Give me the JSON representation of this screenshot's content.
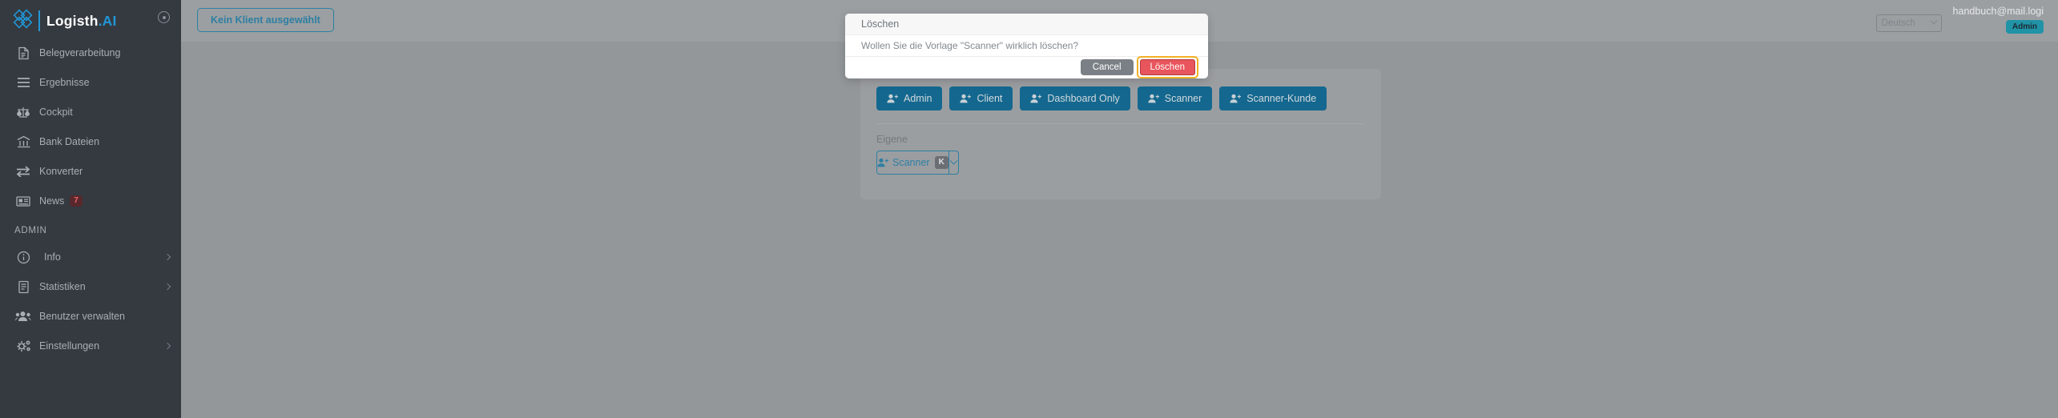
{
  "brand": {
    "name_main": "Logisth",
    "name_dot": ".",
    "name_ai": "AI",
    "logo_icon": "clover-diamond-logo",
    "collapse_icon": "collapse-circle-icon"
  },
  "sidebar": {
    "items": [
      {
        "label": "Belegverarbeitung",
        "icon": "document-icon",
        "badge": null,
        "chevron": false
      },
      {
        "label": "Ergebnisse",
        "icon": "list-lines-icon",
        "badge": null,
        "chevron": false
      },
      {
        "label": "Cockpit",
        "icon": "scales-balance-icon",
        "badge": null,
        "chevron": false
      },
      {
        "label": "Bank Dateien",
        "icon": "bank-icon",
        "badge": null,
        "chevron": false
      },
      {
        "label": "Konverter",
        "icon": "exchange-arrows-icon",
        "badge": null,
        "chevron": false
      },
      {
        "label": "News",
        "icon": "newspaper-icon",
        "badge": "7",
        "chevron": false
      }
    ],
    "section_label": "ADMIN",
    "admin_items": [
      {
        "label": "Info",
        "icon": "info-circle-icon",
        "badge": null,
        "chevron": true
      },
      {
        "label": "Statistiken",
        "icon": "book-icon",
        "badge": null,
        "chevron": true
      },
      {
        "label": "Benutzer verwalten",
        "icon": "users-group-icon",
        "badge": null,
        "chevron": false
      },
      {
        "label": "Einstellungen",
        "icon": "gears-icon",
        "badge": null,
        "chevron": true
      }
    ]
  },
  "topbar": {
    "client_button": "Kein Klient ausgewählt",
    "language": "Deutsch",
    "language_chevron_icon": "chevron-down-icon",
    "user_email": "handbuch@mail.logi",
    "user_role": "Admin"
  },
  "card": {
    "roles": [
      {
        "label": "Admin",
        "icon": "user-plus-icon"
      },
      {
        "label": "Client",
        "icon": "user-plus-icon"
      },
      {
        "label": "Dashboard Only",
        "icon": "user-plus-icon"
      },
      {
        "label": "Scanner",
        "icon": "user-plus-icon"
      },
      {
        "label": "Scanner-Kunde",
        "icon": "user-plus-icon"
      }
    ],
    "own_label": "Eigene",
    "own_item": {
      "label": "Scanner",
      "icon": "user-plus-icon",
      "badge": "K",
      "caret_icon": "chevron-down-icon"
    }
  },
  "modal": {
    "title": "Löschen",
    "message": "Wollen Sie die Vorlage \"Scanner\" wirklich löschen?",
    "cancel_label": "Cancel",
    "confirm_label": "Löschen"
  },
  "colors": {
    "sidebar_bg": "#343a40",
    "accent_blue": "#2196d6",
    "role_button": "#14688f",
    "link_blue": "#2d7fa3",
    "danger_red": "#e8555c",
    "focus_ring": "#f3b125",
    "role_badge_teal": "#2193a6",
    "news_badge_red": "#e9656c"
  }
}
